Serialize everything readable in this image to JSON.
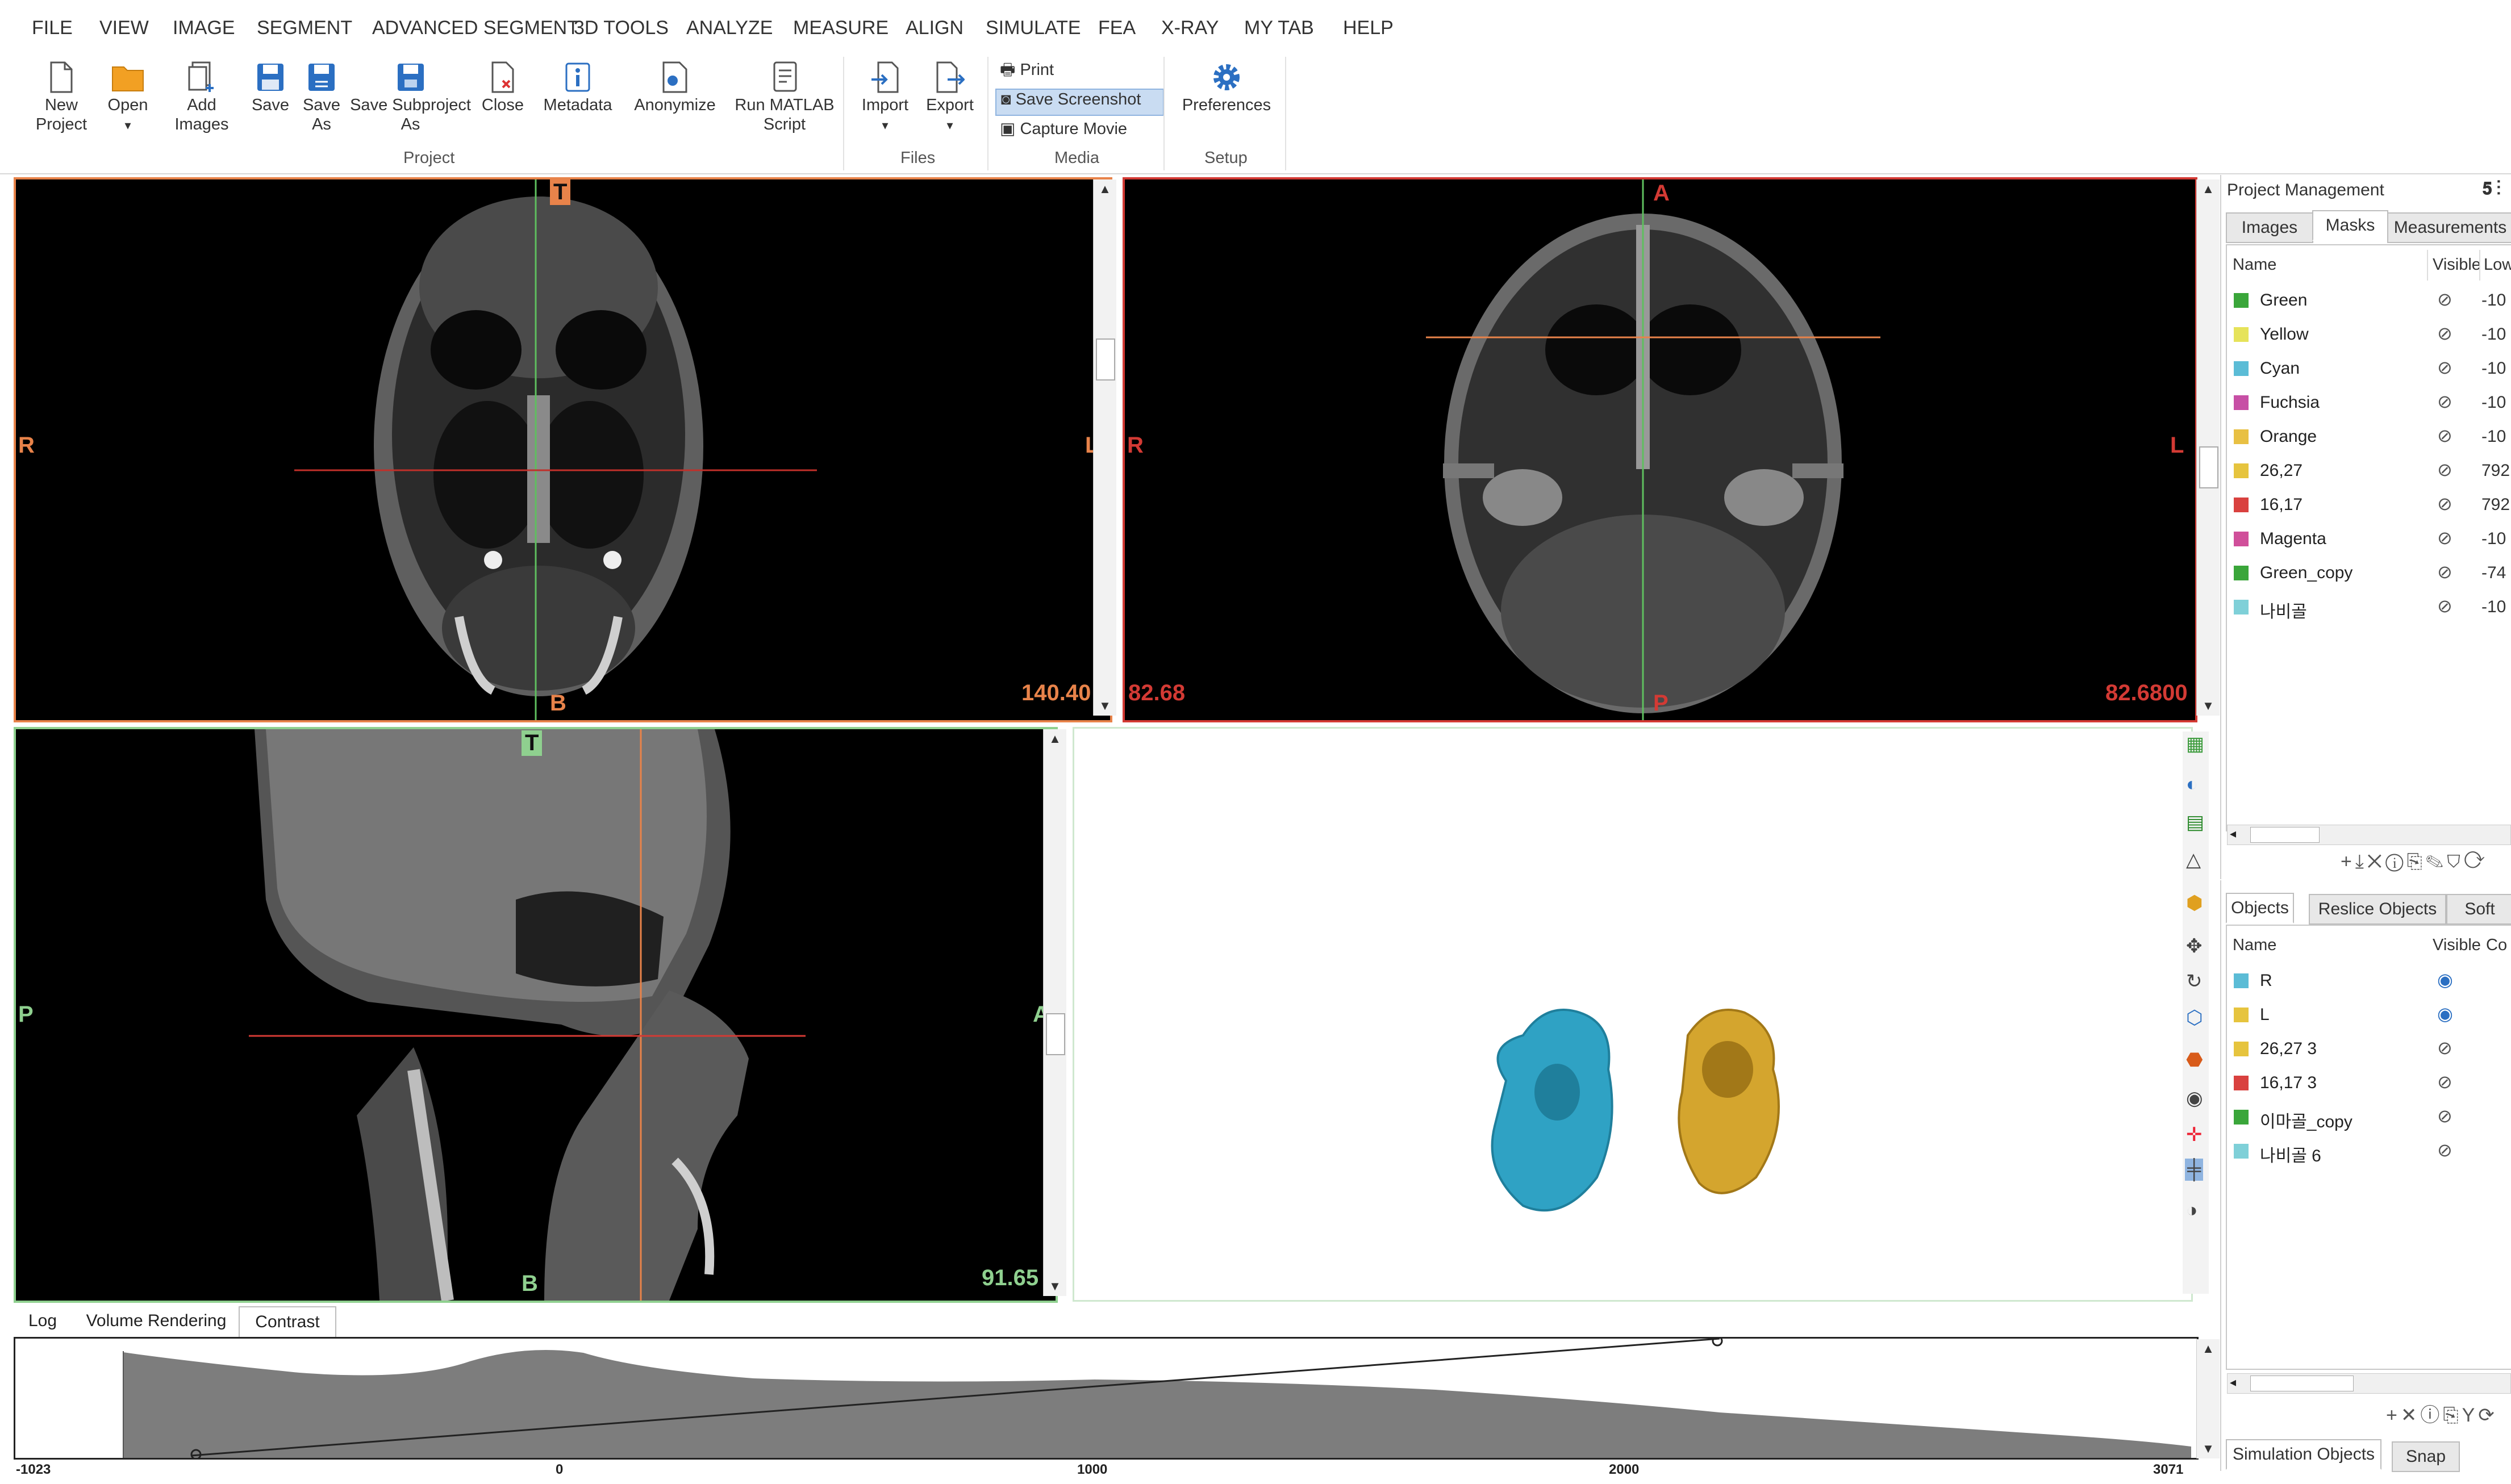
{
  "menu": [
    "FILE",
    "VIEW",
    "IMAGE",
    "SEGMENT",
    "ADVANCED SEGMENT",
    "3D TOOLS",
    "ANALYZE",
    "MEASURE",
    "ALIGN",
    "SIMULATE",
    "FEA",
    "X-RAY",
    "MY TAB",
    "HELP"
  ],
  "ribbon": {
    "project_buttons": [
      "New Project",
      "Open",
      "Add Images",
      "Save",
      "Save As",
      "Save Subproject As",
      "Close",
      "Metadata",
      "Anonymize",
      "Run MATLAB Script"
    ],
    "project_label": "Project",
    "files_buttons": [
      "Import",
      "Export"
    ],
    "files_label": "Files",
    "media_items": [
      "Print",
      "Save Screenshot",
      "Capture Movie"
    ],
    "media_label": "Media",
    "setup_buttons": [
      "Preferences"
    ],
    "setup_label": "Setup"
  },
  "views": {
    "coronal": {
      "top": "T",
      "bottom": "B",
      "left": "R",
      "right": "L",
      "value": "140.40"
    },
    "axial": {
      "top": "A",
      "bottom": "P",
      "left": "R",
      "right": "L",
      "value_left": "82.68",
      "value_right": "82.6800"
    },
    "sagittal": {
      "top": "T",
      "bottom": "B",
      "left": "P",
      "right": "A",
      "value": "91.65"
    }
  },
  "project_management": {
    "title": "Project Management",
    "tabs": [
      "Images",
      "Masks",
      "Measurements"
    ],
    "columns": [
      "Name",
      "Visible",
      "Low"
    ],
    "masks": [
      {
        "name": "Green",
        "color": "#3aa63a",
        "low": "-10"
      },
      {
        "name": "Yellow",
        "color": "#e6e35a",
        "low": "-10"
      },
      {
        "name": "Cyan",
        "color": "#5bbcd6",
        "low": "-10"
      },
      {
        "name": "Fuchsia",
        "color": "#c74fa5",
        "low": "-10"
      },
      {
        "name": "Orange",
        "color": "#e8c043",
        "low": "-10"
      },
      {
        "name": "26,27",
        "color": "#e6c43e",
        "low": "792"
      },
      {
        "name": "16,17",
        "color": "#d9413f",
        "low": "792"
      },
      {
        "name": "Magenta",
        "color": "#d04f9a",
        "low": "-10"
      },
      {
        "name": "Green_copy",
        "color": "#3aa63a",
        "low": "-74"
      },
      {
        "name": "나비골",
        "color": "#7fd0d8",
        "low": "-10"
      }
    ]
  },
  "objects_panel": {
    "tabs": [
      "Objects",
      "Reslice Objects",
      "Soft"
    ],
    "columns": [
      "Name",
      "Visible",
      "Co"
    ],
    "objects": [
      {
        "name": "R",
        "color": "#5bbcd6",
        "visible": "true"
      },
      {
        "name": "L",
        "color": "#e6c43e",
        "visible": "true"
      },
      {
        "name": "26,27 3",
        "color": "#e6c43e",
        "visible": "false"
      },
      {
        "name": "16,17 3",
        "color": "#d9413f",
        "visible": "false"
      },
      {
        "name": "이마골_copy",
        "color": "#3aa63a",
        "visible": "false"
      },
      {
        "name": "나비골 6",
        "color": "#7fd0d8",
        "visible": "false"
      }
    ]
  },
  "simulation_tabs": [
    "Simulation Objects",
    "Snap"
  ],
  "bottom_tabs": [
    "Log",
    "Volume Rendering",
    "Contrast"
  ],
  "histogram": {
    "axis_labels": [
      "-1023",
      "0",
      "1000",
      "2000",
      "3071"
    ]
  }
}
